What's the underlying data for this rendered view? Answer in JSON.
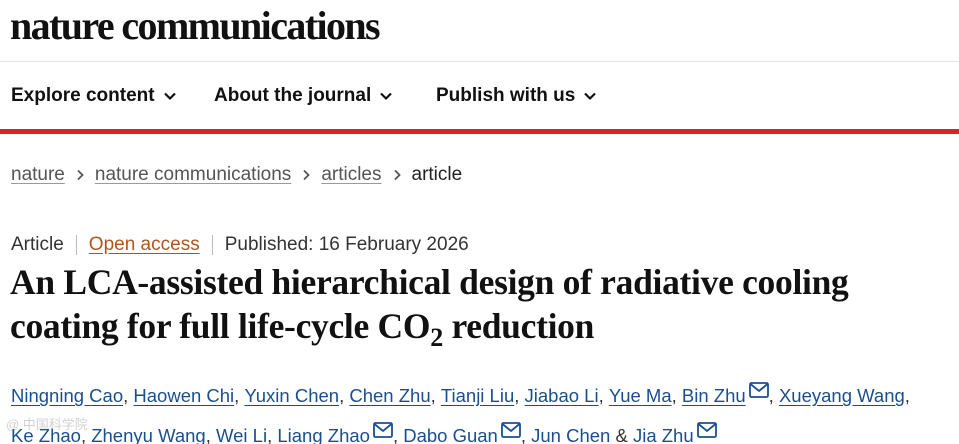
{
  "brand": {
    "name": "nature communications"
  },
  "nav": {
    "items": [
      {
        "label": "Explore content"
      },
      {
        "label": "About the journal"
      },
      {
        "label": "Publish with us"
      }
    ]
  },
  "breadcrumb": {
    "items": [
      "nature",
      "nature communications",
      "articles"
    ],
    "current": "article"
  },
  "article": {
    "type": "Article",
    "access": "Open access",
    "published": "Published: 16 February 2026",
    "title_part1": "An LCA-assisted hierarchical design of radiative cooling coating for full life-cycle CO",
    "title_sub": "2",
    "title_part2": " reduction",
    "authors": [
      {
        "name": "Ningning Cao",
        "corresponding": false
      },
      {
        "name": "Haowen Chi",
        "corresponding": false
      },
      {
        "name": "Yuxin Chen",
        "corresponding": false
      },
      {
        "name": "Chen Zhu",
        "corresponding": false
      },
      {
        "name": "Tianji Liu",
        "corresponding": false
      },
      {
        "name": "Jiabao Li",
        "corresponding": false
      },
      {
        "name": "Yue Ma",
        "corresponding": false
      },
      {
        "name": "Bin Zhu",
        "corresponding": true
      },
      {
        "name": "Xueyang Wang",
        "corresponding": false
      },
      {
        "name": "Ke Zhao",
        "corresponding": false
      },
      {
        "name": "Zhenyu Wang",
        "corresponding": false
      },
      {
        "name": "Wei Li",
        "corresponding": false
      },
      {
        "name": "Liang Zhao",
        "corresponding": true
      },
      {
        "name": "Dabo Guan",
        "corresponding": true
      },
      {
        "name": "Jun Chen",
        "corresponding": false
      },
      {
        "name": "Jia Zhu",
        "corresponding": true
      }
    ],
    "last_joiner": "&"
  },
  "colors": {
    "accent_red": "#e0221c",
    "link_blue": "#1a4f8f",
    "open_access": "#b3541e"
  },
  "icons": {
    "nav_chevron": "chevron-down-icon",
    "breadcrumb_sep": "chevron-right-icon",
    "corresponding": "envelope-icon"
  }
}
